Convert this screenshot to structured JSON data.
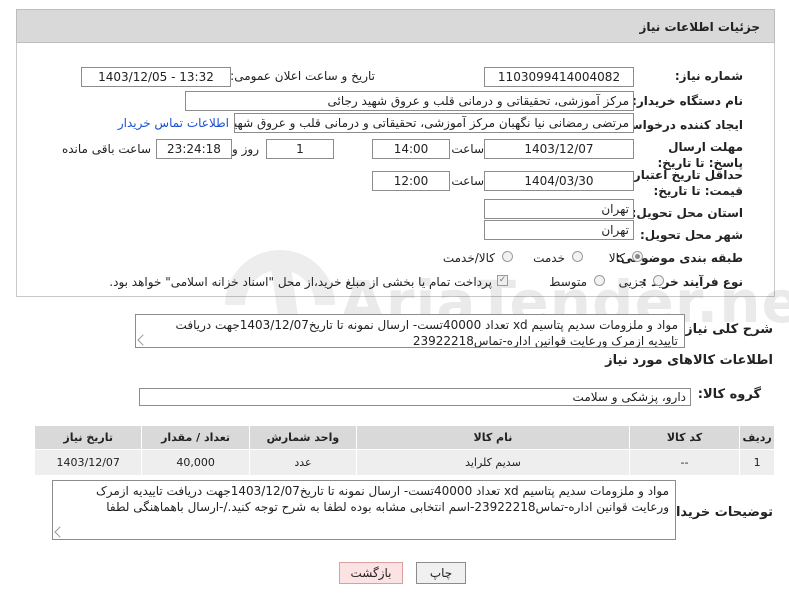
{
  "header": {
    "title": "جزئیات اطلاعات نیاز"
  },
  "form": {
    "need_number_label": "شماره نیاز:",
    "need_number": "1103099414004082",
    "announce_label": "تاریخ و ساعت اعلان عمومی:",
    "announce_value": "1403/12/05 - 13:32",
    "buyer_label": "نام دستگاه خریدار:",
    "buyer_value": "مرکز آموزشی، تحقیقاتی و درمانی قلب و عروق شهید رجائی",
    "creator_label": "ایجاد کننده درخواست:",
    "creator_value": "مرتضی رمضانی نیا نگهبان مرکز آموزشی، تحقیقاتی و درمانی قلب و عروق شهید",
    "contact_link": "اطلاعات تماس خریدار",
    "deadline_label": "مهلت ارسال پاسخ: تا تاریخ:",
    "deadline_date": "1403/12/07",
    "time_label": "ساعت",
    "deadline_time": "14:00",
    "days_value": "1",
    "days_label": "روز و",
    "remaining_time": "23:24:18",
    "remaining_label": "ساعت باقی مانده",
    "min_validity_label": "حداقل تاریخ اعتبار قیمت: تا تاریخ:",
    "validity_date": "1404/03/30",
    "validity_time_label": "ساعت",
    "validity_time": "12:00",
    "province_label": "استان محل تحویل:",
    "province_value": "تهران",
    "city_label": "شهر محل تحویل:",
    "city_value": "تهران",
    "category_label": "طبقه بندی موضوعی:",
    "category_options": [
      "کالا",
      "خدمت",
      "کالا/خدمت"
    ],
    "category_selected": "کالا",
    "process_label": "نوع فرآیند خرید :",
    "process_options": [
      "جزیی",
      "متوسط"
    ],
    "process_note": "پرداخت تمام یا بخشی از مبلغ خرید،از محل \"اسناد خزانه اسلامی\" خواهد بود."
  },
  "description": {
    "label": "شرح کلی نیاز:",
    "text": "مواد و ملزومات سدیم پتاسیم xd  تعداد 40000تست- ارسال نمونه تا تاریخ1403/12/07جهت دریافت تاییدیه ازمرک ورعایت قوانین اداره-تماس23922218"
  },
  "goods_section": {
    "title": "اطلاعات کالاهای مورد نیاز",
    "group_label": "گروه کالا:",
    "group_value": "دارو، پزشکی و سلامت"
  },
  "table": {
    "headers": [
      "ردیف",
      "کد کالا",
      "نام کالا",
      "واحد شمارش",
      "تعداد / مقدار",
      "تاریخ نیاز"
    ],
    "rows": [
      [
        "1",
        "--",
        "سدیم کلراید",
        "عدد",
        "40,000",
        "1403/12/07"
      ]
    ]
  },
  "buyer_notes": {
    "label": "توضیحات خریدار:",
    "text": "مواد و ملزومات سدیم پتاسیم xd  تعداد 40000تست- ارسال نمونه تا تاریخ1403/12/07جهت دریافت تاییدیه ازمرک ورعایت قوانین اداره-تماس23922218-اسم انتخابی مشابه بوده لطفا به شرح توجه کنید./-ارسال باهماهنگی لطفا"
  },
  "buttons": {
    "print": "چاپ",
    "back": "بازگشت"
  },
  "watermark": "AriaTender.net"
}
